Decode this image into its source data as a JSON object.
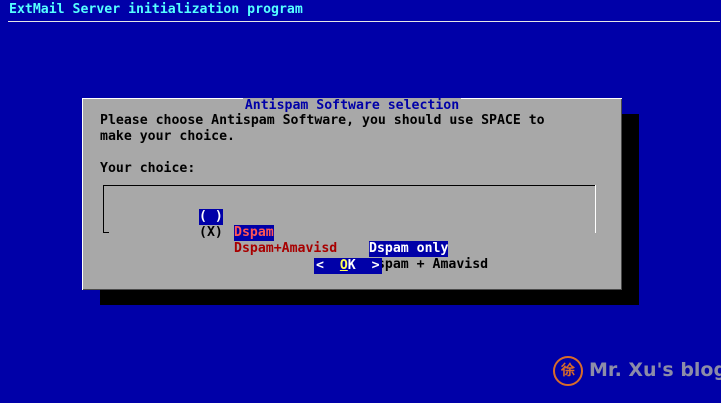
{
  "backtitle": "ExtMail Server initialization program",
  "dialog": {
    "title": "Antispam Software selection",
    "prompt_line1": "Please choose Antispam Software, you should use SPACE to",
    "prompt_line2": "make your choice.",
    "choice_label": "Your choice:",
    "items": [
      {
        "check": "( )",
        "tag": "Dspam",
        "desc": "Dspam only",
        "selected": true
      },
      {
        "check": "(X)",
        "tag": "Dspam+Amavisd",
        "desc": "Dspam + Amavisd",
        "selected": false
      }
    ],
    "ok_left": "<",
    "ok_hot": "O",
    "ok_rest": "K",
    "ok_right": ">"
  },
  "watermark": {
    "icon_glyph": "徐",
    "text": "Mr. Xu's blog"
  },
  "colors": {
    "background": "#0000a8",
    "dialog": "#a8a8a8",
    "selection": "#0000a8",
    "tag": "#a80000"
  }
}
